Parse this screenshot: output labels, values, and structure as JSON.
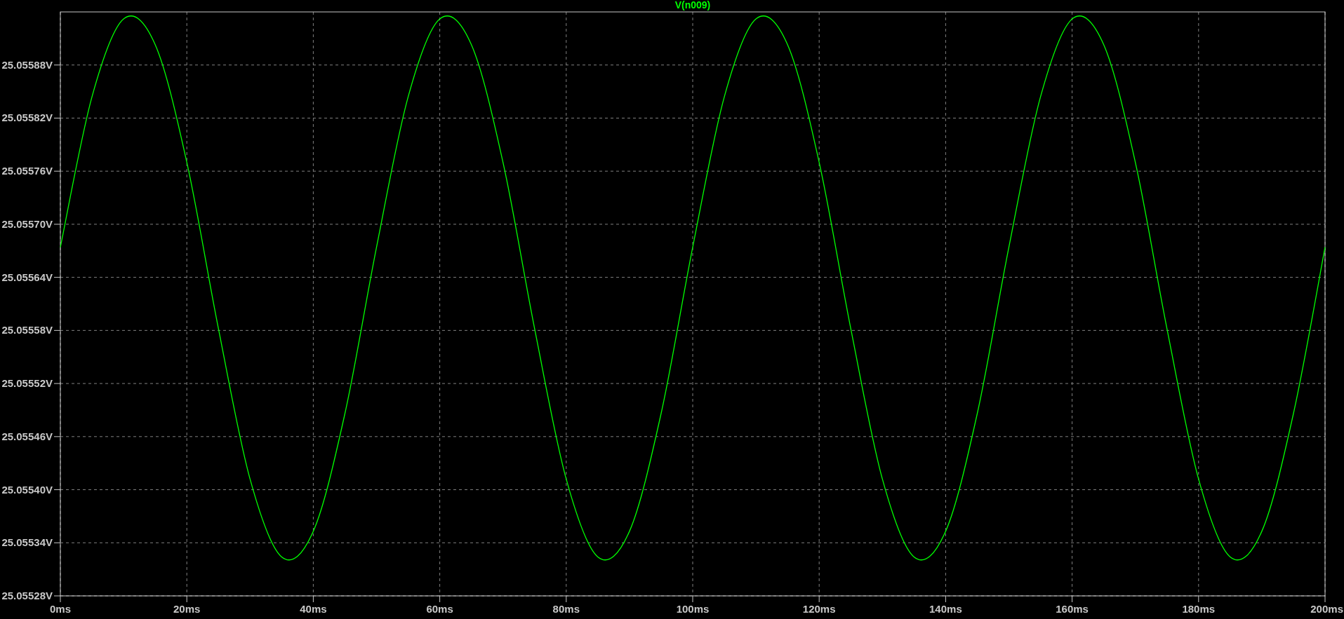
{
  "chart_data": {
    "type": "line",
    "title": "V(n009)",
    "grid": true,
    "x": [
      0,
      5,
      10,
      15,
      20,
      25,
      30,
      35,
      40,
      45,
      50,
      55,
      60,
      65,
      70,
      75,
      80,
      85,
      90,
      95,
      100,
      105,
      110,
      115,
      120,
      125,
      130,
      135,
      140,
      145,
      150,
      155,
      160,
      165,
      170,
      175,
      180,
      185,
      190,
      195,
      200
    ],
    "series": [
      {
        "color": "#00ff00",
        "values": [
          25.055674,
          25.055844,
          25.055932,
          25.055903,
          25.05577,
          25.055582,
          25.055412,
          25.055324,
          25.055353,
          25.055486,
          25.055674,
          25.055844,
          25.055932,
          25.055903,
          25.05577,
          25.055582,
          25.055412,
          25.055324,
          25.055353,
          25.055486,
          25.055674,
          25.055844,
          25.055932,
          25.055903,
          25.05577,
          25.055582,
          25.055412,
          25.055324,
          25.055353,
          25.055486,
          25.055674,
          25.055844,
          25.055932,
          25.055903,
          25.05577,
          25.055582,
          25.055412,
          25.055324,
          25.055353,
          25.055486,
          25.055674
        ]
      }
    ],
    "xlim": [
      0,
      200
    ],
    "ylim": [
      25.05528,
      25.05594
    ],
    "xticks": [
      {
        "value": 0,
        "label": "0ms"
      },
      {
        "value": 20,
        "label": "20ms"
      },
      {
        "value": 40,
        "label": "40ms"
      },
      {
        "value": 60,
        "label": "60ms"
      },
      {
        "value": 80,
        "label": "80ms"
      },
      {
        "value": 100,
        "label": "100ms"
      },
      {
        "value": 120,
        "label": "120ms"
      },
      {
        "value": 140,
        "label": "140ms"
      },
      {
        "value": 160,
        "label": "160ms"
      },
      {
        "value": 180,
        "label": "180ms"
      },
      {
        "value": 200,
        "label": "200ms"
      }
    ],
    "yticks": [
      {
        "value": 25.05528,
        "label": "25.05528V"
      },
      {
        "value": 25.05534,
        "label": "25.05534V"
      },
      {
        "value": 25.0554,
        "label": "25.05540V"
      },
      {
        "value": 25.05546,
        "label": "25.05546V"
      },
      {
        "value": 25.05552,
        "label": "25.05552V"
      },
      {
        "value": 25.05558,
        "label": "25.05558V"
      },
      {
        "value": 25.05564,
        "label": "25.05564V"
      },
      {
        "value": 25.0557,
        "label": "25.05570V"
      },
      {
        "value": 25.05576,
        "label": "25.05576V"
      },
      {
        "value": 25.05582,
        "label": "25.05582V"
      },
      {
        "value": 25.05588,
        "label": "25.05588V"
      }
    ]
  }
}
